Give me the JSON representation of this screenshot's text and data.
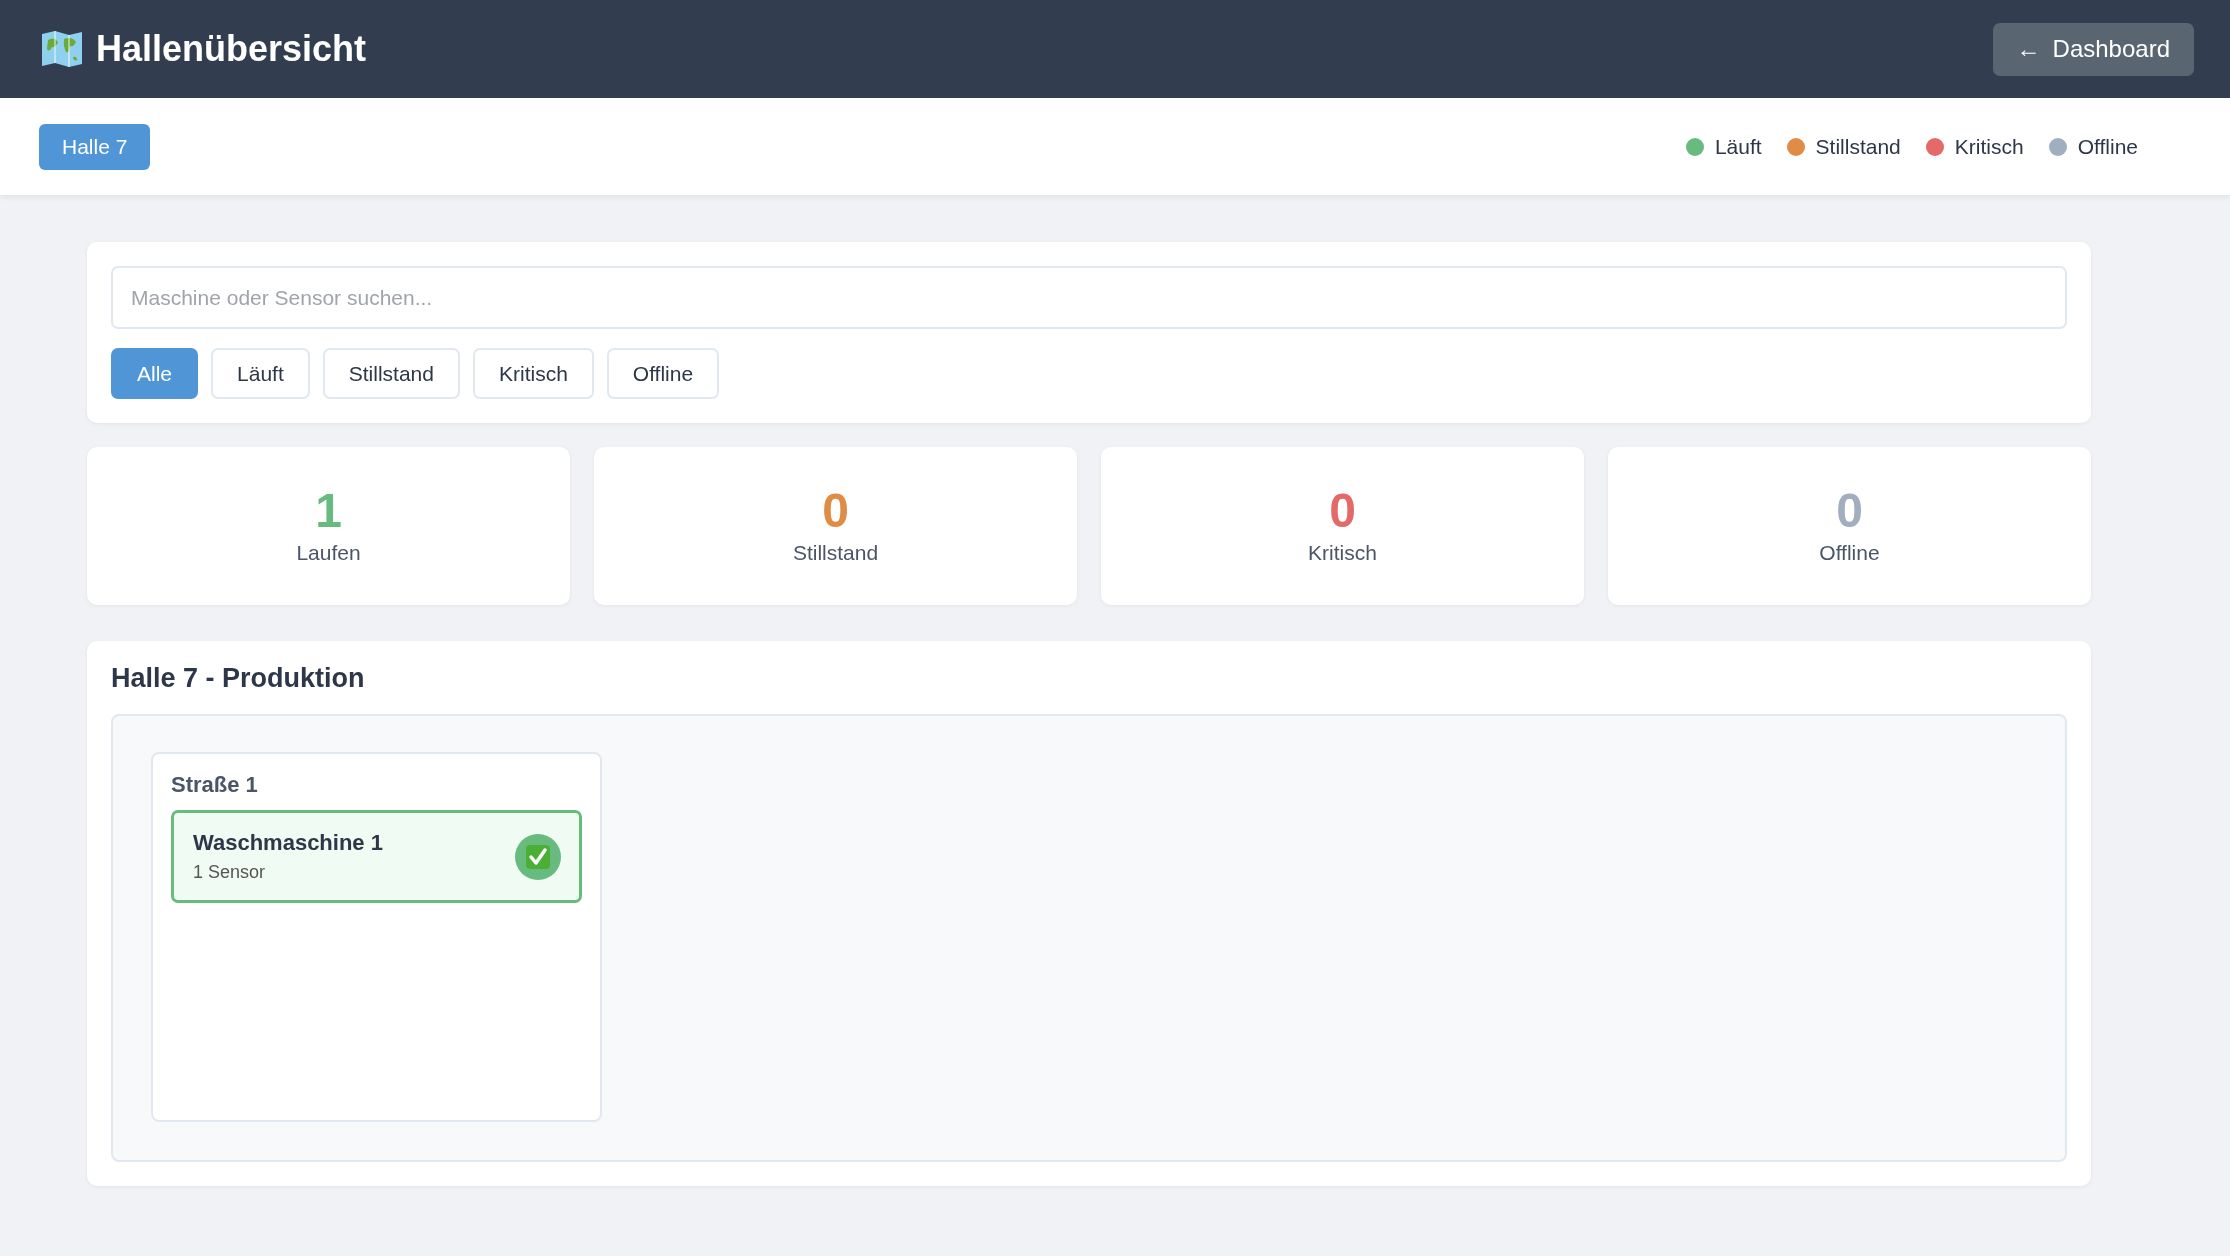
{
  "header": {
    "title": "Hallenübersicht",
    "back_button": {
      "arrow": "←",
      "label": "Dashboard"
    }
  },
  "hall_tabs": [
    {
      "label": "Halle 7",
      "selected": true
    }
  ],
  "legend": [
    {
      "label": "Läuft",
      "color": "#68bb7e"
    },
    {
      "label": "Stillstand",
      "color": "#e08c46"
    },
    {
      "label": "Kritisch",
      "color": "#e46a6a"
    },
    {
      "label": "Offline",
      "color": "#a0aec0"
    }
  ],
  "search": {
    "placeholder": "Maschine oder Sensor suchen..."
  },
  "filters": [
    {
      "label": "Alle",
      "selected": true
    },
    {
      "label": "Läuft",
      "selected": false
    },
    {
      "label": "Stillstand",
      "selected": false
    },
    {
      "label": "Kritisch",
      "selected": false
    },
    {
      "label": "Offline",
      "selected": false
    }
  ],
  "stats": [
    {
      "value": "1",
      "label": "Laufen",
      "color": "#68bb7e"
    },
    {
      "value": "0",
      "label": "Stillstand",
      "color": "#e08c46"
    },
    {
      "value": "0",
      "label": "Kritisch",
      "color": "#e46a6a"
    },
    {
      "value": "0",
      "label": "Offline",
      "color": "#a0aec0"
    }
  ],
  "hall": {
    "title": "Halle 7 - Produktion",
    "lines": [
      {
        "name": "Straße 1",
        "machines": [
          {
            "name": "Waschmaschine 1",
            "sensors": "1 Sensor",
            "kind": "running"
          }
        ]
      }
    ]
  }
}
